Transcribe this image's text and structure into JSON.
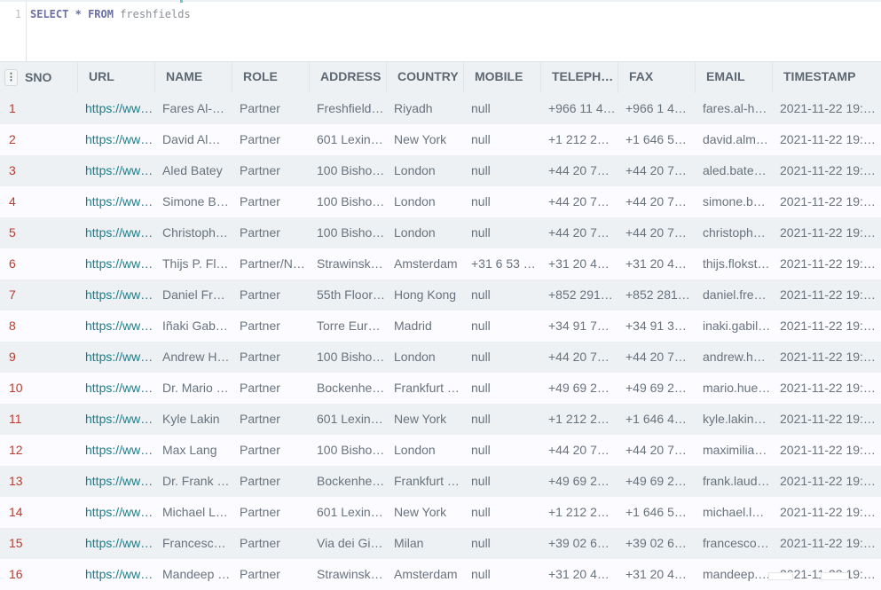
{
  "editor": {
    "line_number": "1",
    "keyword_select": "SELECT",
    "star": "*",
    "keyword_from": "FROM",
    "table_name": "freshfields"
  },
  "grid": {
    "menu_icon": "⋮",
    "columns": [
      "SNO",
      "URL",
      "NAME",
      "ROLE",
      "ADDRESS",
      "COUNTRY",
      "MOBILE",
      "TELEPH…",
      "FAX",
      "EMAIL",
      "TIMESTAMP"
    ],
    "rows": [
      [
        "1",
        "https://ww…",
        "Fares Al-…",
        "Partner",
        "Freshfield…",
        "Riyadh",
        "null",
        "+966 11 4…",
        "+966 1 4…",
        "fares.al-h…",
        "2021-11-22 19:…"
      ],
      [
        "2",
        "https://ww…",
        "David Al…",
        "Partner",
        "601 Lexin…",
        "New York",
        "null",
        "+1 212 2…",
        "+1 646 5…",
        "david.alm…",
        "2021-11-22 19:…"
      ],
      [
        "3",
        "https://ww…",
        "Aled Batey",
        "Partner",
        "100 Bisho…",
        "London",
        "null",
        "+44 20 7…",
        "+44 20 7…",
        "aled.bate…",
        "2021-11-22 19:…"
      ],
      [
        "4",
        "https://ww…",
        "Simone B…",
        "Partner",
        "100 Bisho…",
        "London",
        "null",
        "+44 20 7…",
        "+44 20 7…",
        "simone.b…",
        "2021-11-22 19:…"
      ],
      [
        "5",
        "https://ww…",
        "Christoph…",
        "Partner",
        "100 Bisho…",
        "London",
        "null",
        "+44 20 7…",
        "+44 20 7…",
        "christoph…",
        "2021-11-22 19:…"
      ],
      [
        "6",
        "https://ww…",
        "Thijs P. Fl…",
        "Partner/N…",
        "Strawinsk…",
        "Amsterdam",
        "+31 6 53 …",
        "+31 20 4…",
        "+31 20 4…",
        "thijs.flokst…",
        "2021-11-22 19:…"
      ],
      [
        "7",
        "https://ww…",
        "Daniel Fr…",
        "Partner",
        "55th Floor…",
        "Hong Kong",
        "null",
        "+852 291…",
        "+852 281…",
        "daniel.fre…",
        "2021-11-22 19:…"
      ],
      [
        "8",
        "https://ww…",
        "Iñaki Gab…",
        "Partner",
        "Torre Eur…",
        "Madrid",
        "null",
        "+34 91 7…",
        "+34 91 3…",
        "inaki.gabil…",
        "2021-11-22 19:…"
      ],
      [
        "9",
        "https://ww…",
        "Andrew H…",
        "Partner",
        "100 Bisho…",
        "London",
        "null",
        "+44 20 7…",
        "+44 20 7…",
        "andrew.h…",
        "2021-11-22 19:…"
      ],
      [
        "10",
        "https://ww…",
        "Dr. Mario …",
        "Partner",
        "Bockenhe…",
        "Frankfurt …",
        "null",
        "+49 69 2…",
        "+49 69 2…",
        "mario.hue…",
        "2021-11-22 19:…"
      ],
      [
        "11",
        "https://ww…",
        "Kyle Lakin",
        "Partner",
        "601 Lexin…",
        "New York",
        "null",
        "+1 212 2…",
        "+1 646 4…",
        "kyle.lakin…",
        "2021-11-22 19:…"
      ],
      [
        "12",
        "https://ww…",
        "Max Lang",
        "Partner",
        "100 Bisho…",
        "London",
        "null",
        "+44 20 7…",
        "+44 20 7…",
        "maximilia…",
        "2021-11-22 19:…"
      ],
      [
        "13",
        "https://ww…",
        "Dr. Frank …",
        "Partner",
        "Bockenhe…",
        "Frankfurt …",
        "null",
        "+49 69 2…",
        "+49 69 2…",
        "frank.laud…",
        "2021-11-22 19:…"
      ],
      [
        "14",
        "https://ww…",
        "Michael L…",
        "Partner",
        "601 Lexin…",
        "New York",
        "null",
        "+1 212 2…",
        "+1 646 5…",
        "michael.l…",
        "2021-11-22 19:…"
      ],
      [
        "15",
        "https://ww…",
        "Francesc…",
        "Partner",
        "Via dei Gi…",
        "Milan",
        "null",
        "+39 02 6…",
        "+39 02 6…",
        "francesco…",
        "2021-11-22 19:…"
      ],
      [
        "16",
        "https://ww…",
        "Mandeep …",
        "Partner",
        "Strawinsk…",
        "Amsterdam",
        "null",
        "+31 20 4…",
        "+31 20 4…",
        "mandeep.…",
        "2021-11-22 19:…"
      ]
    ]
  },
  "colors": {
    "sno": "#c0392b",
    "url": "#1b7d8c",
    "header_bg": "#edf1f3"
  }
}
